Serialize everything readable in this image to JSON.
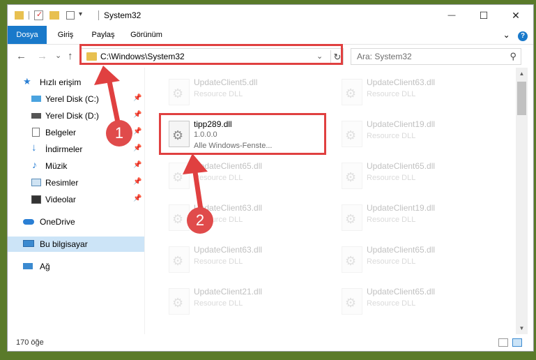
{
  "window": {
    "title": "System32",
    "minimize_glyph": "—",
    "maximize_glyph": "☐",
    "close_glyph": "✕"
  },
  "ribbon": {
    "tabs": [
      "Dosya",
      "Giriş",
      "Paylaş",
      "Görünüm"
    ],
    "expand_glyph": "⌄",
    "help_glyph": "?"
  },
  "nav": {
    "back_glyph": "←",
    "forward_glyph": "→",
    "recent_glyph": "⌄",
    "up_glyph": "↑",
    "address_path": "C:\\Windows\\System32",
    "address_dropdown_glyph": "⌄",
    "refresh_glyph": "↻",
    "search_placeholder": "Ara: System32",
    "search_glyph": "⚲"
  },
  "sidebar": {
    "quick_access": "Hızlı erişim",
    "items": [
      {
        "label": "Yerel Disk (C:)",
        "icon": "drive-icon",
        "pinned": true
      },
      {
        "label": "Yerel Disk (D:)",
        "icon": "drive-icon",
        "pinned": true
      },
      {
        "label": "Belgeler",
        "icon": "documents-icon",
        "pinned": true
      },
      {
        "label": "İndirmeler",
        "icon": "downloads-icon",
        "pinned": true
      },
      {
        "label": "Müzik",
        "icon": "music-icon",
        "pinned": true
      },
      {
        "label": "Resimler",
        "icon": "pictures-icon",
        "pinned": true
      },
      {
        "label": "Videolar",
        "icon": "videos-icon",
        "pinned": true
      }
    ],
    "onedrive": "OneDrive",
    "this_pc": "Bu bilgisayar",
    "network": "Ağ"
  },
  "files": {
    "highlighted": {
      "name": "tipp289.dll",
      "version": "1.0.0.0",
      "description": "Alle Windows-Fenste..."
    },
    "faded_left": [
      {
        "name": "UpdateClient5.dll",
        "type": "Resource DLL"
      },
      {
        "name": "UpdateClient65.dll",
        "type": "Resource DLL"
      },
      {
        "name": "UpdateClient63.dll",
        "type": "Resource DLL"
      },
      {
        "name": "UpdateClient63.dll",
        "type": "Resource DLL"
      },
      {
        "name": "UpdateClient21.dll",
        "type": "Resource DLL"
      }
    ],
    "faded_right": [
      {
        "name": "UpdateClient63.dll",
        "type": "Resource DLL"
      },
      {
        "name": "UpdateClient19.dll",
        "type": "Resource DLL"
      },
      {
        "name": "UpdateClient65.dll",
        "type": "Resource DLL"
      },
      {
        "name": "UpdateClient19.dll",
        "type": "Resource DLL"
      },
      {
        "name": "UpdateClient65.dll",
        "type": "Resource DLL"
      },
      {
        "name": "UpdateClient65.dll",
        "type": "Resource DLL"
      }
    ]
  },
  "status": {
    "item_count": "170 öğe"
  },
  "annotations": {
    "step1": "1",
    "step2": "2",
    "color": "#e04040"
  }
}
